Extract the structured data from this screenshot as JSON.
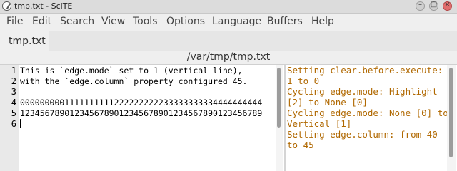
{
  "window": {
    "title": "tmp.txt - SciTE"
  },
  "menubar": {
    "items": [
      "File",
      "Edit",
      "Search",
      "View",
      "Tools",
      "Options",
      "Language",
      "Buffers",
      "Help"
    ]
  },
  "tabs": [
    {
      "label": "tmp.txt",
      "active": true
    }
  ],
  "path": "/var/tmp/tmp.txt",
  "editor": {
    "line_numbers": [
      "1",
      "2",
      "3",
      "4",
      "5",
      "6"
    ],
    "lines": [
      "This is `edge.mode` set to 1 (vertical line),",
      "with the `edge.column` property configured 45.",
      "",
      "0000000001111111111222222222233333333334444444444",
      "1234567890123456789012345678901234567890123456789",
      ""
    ]
  },
  "output": {
    "lines": [
      "Setting clear.before.execute:",
      "1 to 0",
      "Cycling edge.mode: Highlight",
      "[2] to None [0]",
      "Cycling edge.mode: None [0] to",
      "Vertical [1]",
      "Setting edge.column: from 40",
      "to 45"
    ]
  },
  "colors": {
    "output_text": "#b06800",
    "close_button": "#e06c6c"
  }
}
